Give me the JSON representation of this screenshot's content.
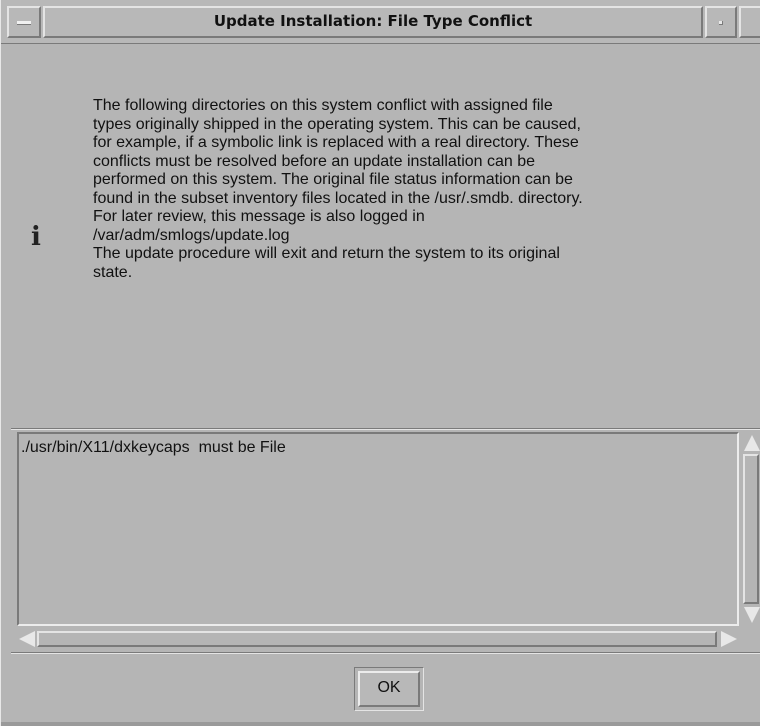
{
  "window": {
    "title": "Update Installation: File Type Conflict"
  },
  "message": {
    "icon": "info-icon",
    "icon_glyph": "i",
    "text": "The following directories on this system conflict with assigned file\ntypes originally shipped in the operating system.  This can be caused,\nfor example, if a symbolic link is replaced with a real directory.  These\nconflicts must be resolved before an update installation can be\nperformed on this system.  The original file status information can be\nfound in the subset inventory files located in the /usr/.smdb. directory.\nFor later review, this message is also logged in\n/var/adm/smlogs/update.log\nThe update procedure will exit and return the system to its original\nstate."
  },
  "list": {
    "items": [
      "./usr/bin/X11/dxkeycaps  must be File"
    ]
  },
  "buttons": {
    "ok_label": "OK"
  }
}
